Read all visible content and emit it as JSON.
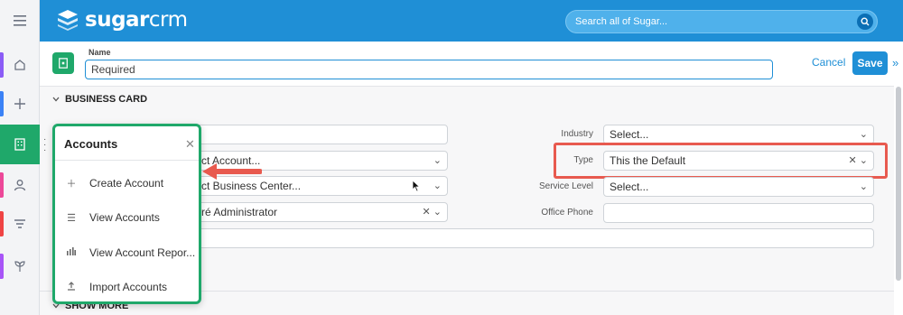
{
  "header": {
    "logo_bold": "sugar",
    "logo_light": "crm",
    "search_placeholder": "Search all of Sugar..."
  },
  "rail": {
    "items": [
      {
        "name": "home",
        "icon": "home-icon",
        "stripe": "#8b5cf6"
      },
      {
        "name": "create",
        "icon": "plus-icon",
        "stripe": "#3b82f6"
      },
      {
        "name": "accounts",
        "icon": "building-icon",
        "active": true
      },
      {
        "name": "contacts",
        "icon": "user-icon",
        "stripe": "#ec4899"
      },
      {
        "name": "filter",
        "icon": "filter-icon",
        "stripe": "#ef4444"
      },
      {
        "name": "opportunities",
        "icon": "plant-icon",
        "stripe": "#a855f7"
      }
    ]
  },
  "record": {
    "name_label": "Name",
    "name_value": "Required",
    "cancel": "Cancel",
    "save": "Save"
  },
  "sections": {
    "business_card": "BUSINESS CARD",
    "show_more": "SHOW MORE"
  },
  "left_fields": {
    "account": "ct Account...",
    "business_center": "ct Business Center...",
    "assigned": "ré Administrator"
  },
  "right_fields": {
    "industry_label": "Industry",
    "industry_value": "Select...",
    "type_label": "Type",
    "type_value": "This the Default",
    "service_label": "Service Level",
    "service_value": "Select...",
    "phone_label": "Office Phone",
    "phone_value": ""
  },
  "popup": {
    "title": "Accounts",
    "items": [
      {
        "label": "Create Account",
        "icon": "plus-icon"
      },
      {
        "label": "View Accounts",
        "icon": "list-icon"
      },
      {
        "label": "View Account Repor...",
        "icon": "bar-chart-icon"
      },
      {
        "label": "Import Accounts",
        "icon": "upload-icon"
      }
    ]
  },
  "colors": {
    "brand_blue": "#1f8fd6",
    "accounts_green": "#1fa86a",
    "highlight_red": "#e85a4f"
  }
}
